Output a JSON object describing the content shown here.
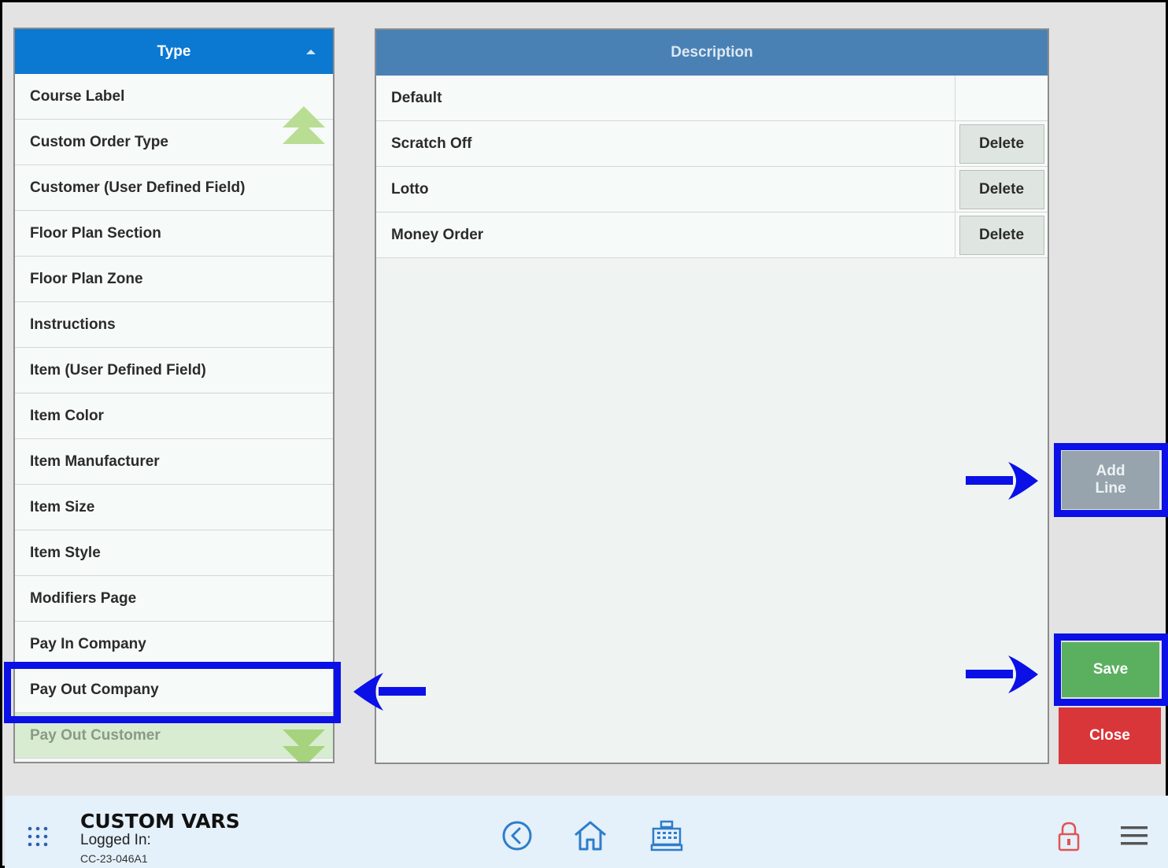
{
  "type_list": {
    "header": "Type",
    "items": [
      "Course Label",
      "Custom Order Type",
      "Customer (User Defined Field)",
      "Floor Plan Section",
      "Floor Plan Zone",
      "Instructions",
      "Item (User Defined Field)",
      "Item Color",
      "Item Manufacturer",
      "Item Size",
      "Item Style",
      "Modifiers Page",
      "Pay In Company",
      "Pay Out Company",
      "Pay Out Customer"
    ],
    "selected": "Pay Out Company"
  },
  "description_table": {
    "header": "Description",
    "rows": [
      {
        "text": "Default",
        "action": ""
      },
      {
        "text": "Scratch Off",
        "action": "Delete"
      },
      {
        "text": "Lotto",
        "action": "Delete"
      },
      {
        "text": "Money Order",
        "action": "Delete"
      }
    ]
  },
  "actions": {
    "add_line": "Add Line",
    "save": "Save",
    "close": "Close"
  },
  "footer": {
    "title": "CUSTOM VARS",
    "logged_in": "Logged In:",
    "station_id": "CC-23-046A1"
  },
  "colors": {
    "type_header": "#0b78d1",
    "desc_header": "#4a81b5",
    "save": "#5bb05f",
    "close": "#d9363a",
    "add_line": "#97a4ad",
    "highlight": "#0a10e6"
  },
  "icons": [
    "grid-menu-icon",
    "back-icon",
    "home-icon",
    "register-icon",
    "lock-icon",
    "hamburger-menu-icon",
    "arrow-right-icon",
    "arrow-left-icon",
    "sort-asc-icon",
    "scroll-up-icon",
    "scroll-down-icon"
  ]
}
